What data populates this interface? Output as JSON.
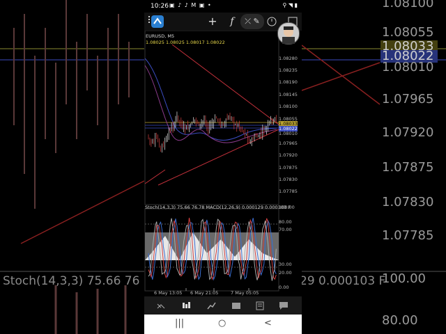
{
  "background": {
    "prices": [
      "1.08100",
      "1.08055",
      "1.08033",
      "1.08022",
      "1.08010",
      "1.07965",
      "1.07920",
      "1.07875",
      "1.07830",
      "1.07785"
    ],
    "stoch": "Stoch(14,3,3) 75.66 76",
    "stoch_right": "29 0.000103 F",
    "levels": [
      "100.00",
      "80.00"
    ]
  },
  "status": {
    "time": "10:26",
    "icons": "▣ ♪ ♪ M ▣ •",
    "right": "⚲ ◥ ▮"
  },
  "toolbar": {
    "plus": "+",
    "fx": "f",
    "tools": "⤫ ✎",
    "more": "⋯"
  },
  "chart": {
    "symbol": "EURUSD, M5",
    "ohlc": "1.08025 1.08025 1.08017 1.08022",
    "price_labels": [
      "1.08280",
      "1.08235",
      "1.08190",
      "1.08145",
      "1.08100",
      "1.08055",
      "1.08033",
      "1.08022",
      "1.08010",
      "1.07965",
      "1.07920",
      "1.07875",
      "1.07830",
      "1.07785"
    ],
    "indicator_label": "Stoch(14,3,3) 75.66 76.78 MACD(12,26,9) 0.000129 0.000103 F",
    "stoch_labels": [
      "100.00",
      "80.00",
      "70.00",
      "30.00",
      "20.00",
      "0.00"
    ],
    "x_labels": [
      "6 May 13:05",
      "6 May 21:05",
      "7 May 05:05"
    ]
  },
  "tabs": [
    "quotes",
    "chart",
    "trade",
    "history",
    "messages"
  ],
  "nav": [
    "|||",
    "○",
    "<"
  ],
  "colors": {
    "bull": "#e8e8e8",
    "bear": "#d24040",
    "trend": "#c0303a",
    "ma_blue": "#3b4cc0"
  }
}
